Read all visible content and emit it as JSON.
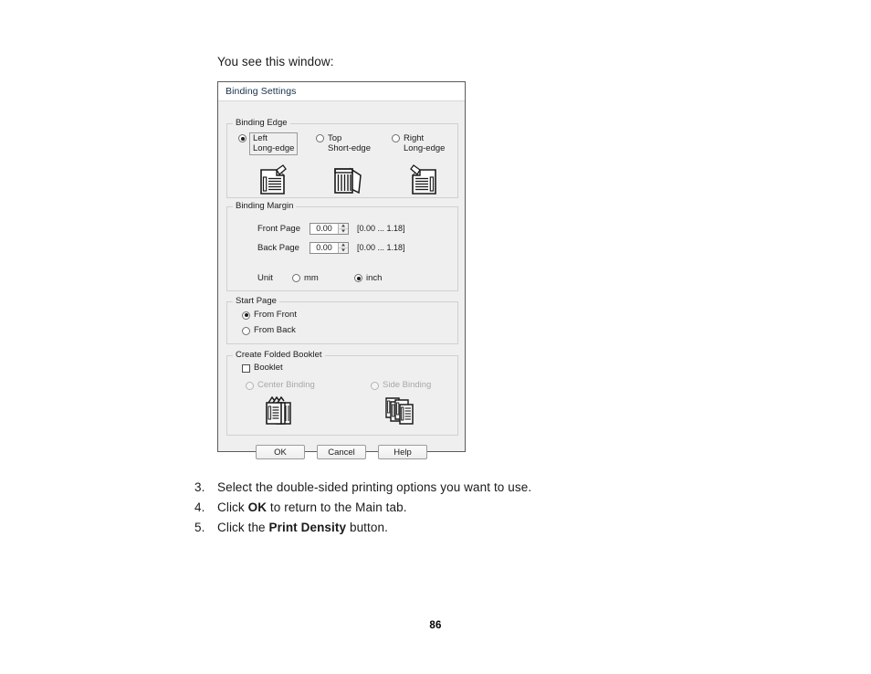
{
  "page": {
    "intro_text": "You see this window:",
    "page_number": "86"
  },
  "dialog": {
    "title": "Binding Settings",
    "binding_edge": {
      "group_label": "Binding Edge",
      "options": [
        {
          "id": "left",
          "line1": "Left",
          "line2": "Long-edge",
          "selected": true,
          "icon": "binding-left-icon"
        },
        {
          "id": "top",
          "line1": "Top",
          "line2": "Short-edge",
          "selected": false,
          "icon": "binding-top-icon"
        },
        {
          "id": "right",
          "line1": "Right",
          "line2": "Long-edge",
          "selected": false,
          "icon": "binding-right-icon"
        }
      ]
    },
    "binding_margin": {
      "group_label": "Binding Margin",
      "front_page": {
        "label": "Front Page",
        "value": "0.00",
        "range": "[0.00 ... 1.18]"
      },
      "back_page": {
        "label": "Back Page",
        "value": "0.00",
        "range": "[0.00 ... 1.18]"
      },
      "unit": {
        "label": "Unit",
        "options": [
          {
            "id": "mm",
            "label": "mm",
            "selected": false
          },
          {
            "id": "inch",
            "label": "inch",
            "selected": true
          }
        ]
      }
    },
    "start_page": {
      "group_label": "Start Page",
      "options": [
        {
          "id": "from-front",
          "label": "From Front",
          "selected": true
        },
        {
          "id": "from-back",
          "label": "From Back",
          "selected": false
        }
      ]
    },
    "create_folded_booklet": {
      "group_label": "Create Folded Booklet",
      "checkbox": {
        "label": "Booklet",
        "checked": false
      },
      "options": [
        {
          "id": "center-binding",
          "label": "Center Binding",
          "selected": false,
          "disabled": true,
          "icon": "center-binding-icon"
        },
        {
          "id": "side-binding",
          "label": "Side Binding",
          "selected": false,
          "disabled": true,
          "icon": "side-binding-icon"
        }
      ]
    },
    "buttons": {
      "ok": "OK",
      "cancel": "Cancel",
      "help": "Help"
    }
  },
  "steps": [
    {
      "number": "3.",
      "prefix": "Select the double-sided printing options you want to use.",
      "bold": "",
      "suffix": ""
    },
    {
      "number": "4.",
      "prefix": "Click ",
      "bold": "OK",
      "suffix": " to return to the Main tab."
    },
    {
      "number": "5.",
      "prefix": "Click the ",
      "bold": "Print Density",
      "suffix": " button."
    }
  ],
  "colors": {
    "dialog_bg": "#efefef",
    "titlebar_bg": "#ffffff",
    "title_text": "#14304a",
    "border": "#5a5a5a",
    "group_border": "#d0d0d0",
    "disabled_text": "#a8a8a8"
  }
}
